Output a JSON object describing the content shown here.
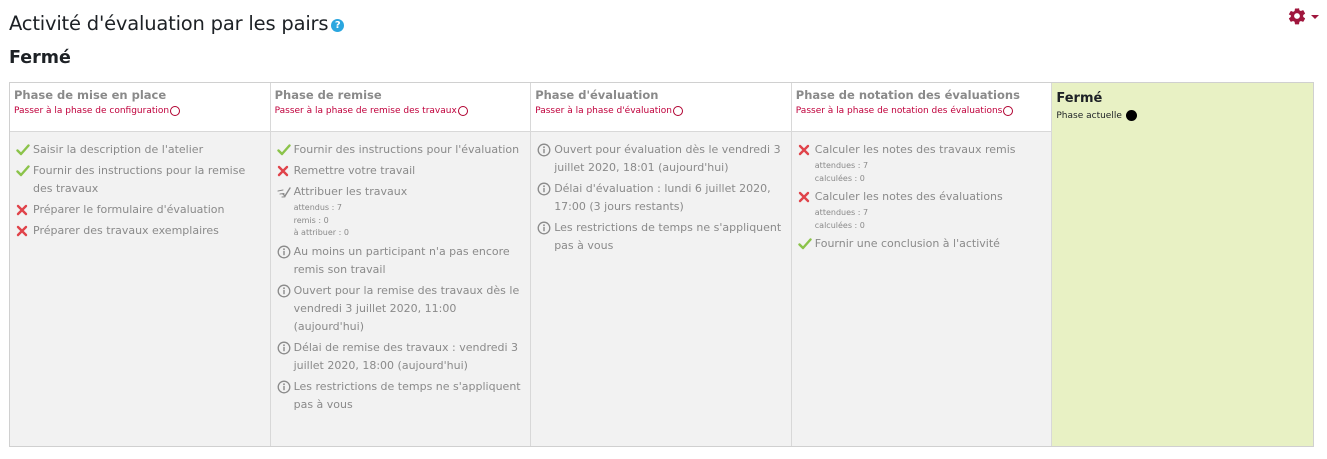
{
  "header": {
    "title": "Activité d'évaluation par les pairs",
    "help_icon": "?",
    "subtitle": "Fermé"
  },
  "colors": {
    "accent": "#a0163d",
    "link": "#c0003c",
    "active_phase_bg": "#e8f1c4",
    "check": "#8bc34a",
    "cross": "#e0434a",
    "help": "#2aa6df"
  },
  "phases": [
    {
      "name": "Phase de mise en place",
      "switch_label": "Passer à la phase de configuration",
      "tasks": [
        {
          "icon": "check-icon",
          "text": "Saisir la description de l'atelier"
        },
        {
          "icon": "check-icon",
          "text": "Fournir des instructions pour la remise des travaux"
        },
        {
          "icon": "cross-icon",
          "text": "Préparer le formulaire d'évaluation"
        },
        {
          "icon": "cross-icon",
          "text": "Préparer des travaux exemplaires"
        }
      ]
    },
    {
      "name": "Phase de remise",
      "switch_label": "Passer à la phase de remise des travaux",
      "tasks": [
        {
          "icon": "check-icon",
          "text": "Fournir des instructions pour l'évaluation"
        },
        {
          "icon": "cross-icon",
          "text": "Remettre votre travail"
        },
        {
          "icon": "allocate-icon",
          "text": "Attribuer les travaux",
          "details": [
            "attendus : 7",
            "remis : 0",
            "à attribuer : 0"
          ]
        },
        {
          "icon": "info-icon",
          "text": "Au moins un participant n'a pas encore remis son travail"
        },
        {
          "icon": "info-icon",
          "text": "Ouvert pour la remise des travaux dès le vendredi 3 juillet 2020, 11:00 (aujourd'hui)"
        },
        {
          "icon": "info-icon",
          "text": "Délai de remise des travaux : vendredi 3 juillet 2020, 18:00 (aujourd'hui)"
        },
        {
          "icon": "info-icon",
          "text": "Les restrictions de temps ne s'appliquent pas à vous"
        }
      ]
    },
    {
      "name": "Phase d'évaluation",
      "switch_label": "Passer à la phase d'évaluation",
      "tasks": [
        {
          "icon": "info-icon",
          "text": "Ouvert pour évaluation dès le vendredi 3 juillet 2020, 18:01 (aujourd'hui)"
        },
        {
          "icon": "info-icon",
          "text": "Délai d'évaluation : lundi 6 juillet 2020, 17:00 (3 jours restants)"
        },
        {
          "icon": "info-icon",
          "text": "Les restrictions de temps ne s'appliquent pas à vous"
        }
      ]
    },
    {
      "name": "Phase de notation des évaluations",
      "switch_label": "Passer à la phase de notation des évaluations",
      "tasks": [
        {
          "icon": "cross-icon",
          "text": "Calculer les notes des travaux remis",
          "details": [
            "attendues : 7",
            "calculées : 0"
          ]
        },
        {
          "icon": "cross-icon",
          "text": "Calculer les notes des évaluations",
          "details": [
            "attendues : 7",
            "calculées : 0"
          ]
        },
        {
          "icon": "check-icon",
          "text": "Fournir une conclusion à l'activité"
        }
      ]
    }
  ],
  "active_phase": {
    "name": "Fermé",
    "current_label": "Phase actuelle"
  }
}
